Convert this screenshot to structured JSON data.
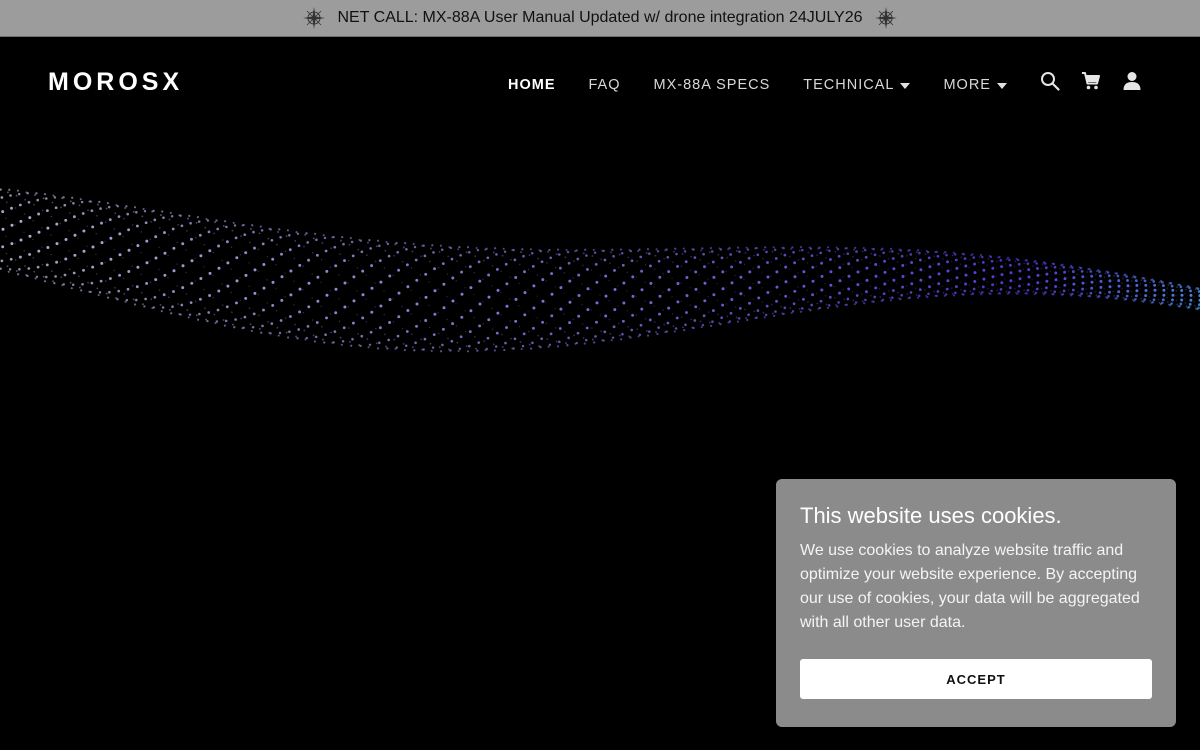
{
  "announcement": {
    "text": "NET CALL: MX-88A User Manual Updated w/ drone integration 24JULY26",
    "left_icon": "compass-icon",
    "right_icon": "compass-icon"
  },
  "header": {
    "logo": "MOROSX",
    "nav": [
      {
        "label": "HOME",
        "active": true
      },
      {
        "label": "FAQ"
      },
      {
        "label": "MX-88A SPECS"
      },
      {
        "label": "TECHNICAL",
        "dropdown": true
      },
      {
        "label": "MORE",
        "dropdown": true
      }
    ],
    "icons": [
      "search-icon",
      "cart-icon",
      "user-icon"
    ]
  },
  "hero": {
    "background_color": "#000000",
    "graphic": "particle-wave"
  },
  "cookie_banner": {
    "title": "This website uses cookies.",
    "body": "We use cookies to analyze website traffic and optimize your website experience. By accepting our use of cookies, your data will be aggregated with all other user data.",
    "accept_label": "ACCEPT",
    "background_color": "#8b8b8b"
  }
}
